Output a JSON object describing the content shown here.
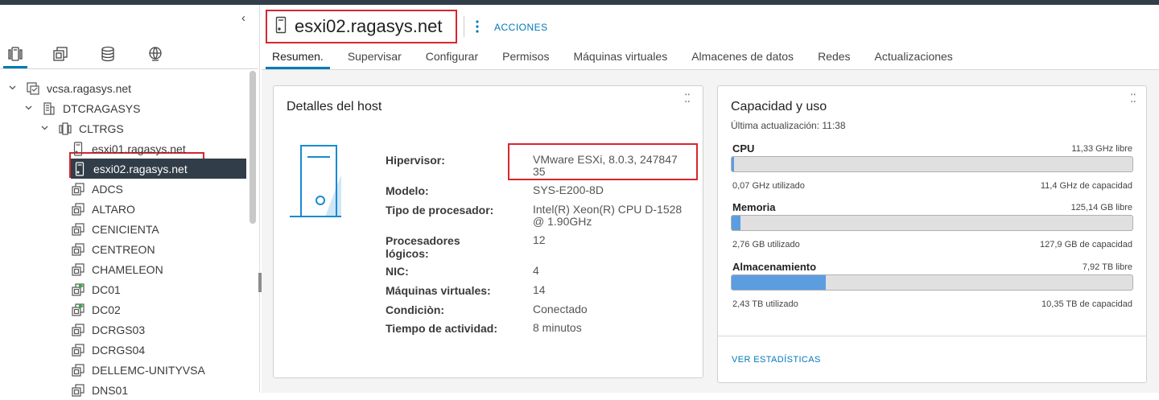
{
  "header": {
    "title": "esxi02.ragasys.net",
    "actions_label": "ACCIONES"
  },
  "tabs": [
    {
      "label": "Resumen."
    },
    {
      "label": "Supervisar"
    },
    {
      "label": "Configurar"
    },
    {
      "label": "Permisos"
    },
    {
      "label": "Máquinas virtuales"
    },
    {
      "label": "Almacenes de datos"
    },
    {
      "label": "Redes"
    },
    {
      "label": "Actualizaciones"
    }
  ],
  "sidebar": {
    "collapse_glyph": "‹",
    "view_icons": [
      "hosts-clusters-icon",
      "vms-templates-icon",
      "storage-icon",
      "networking-icon"
    ],
    "tree": [
      {
        "label": "vcsa.ragasys.net",
        "icon": "vcenter-icon",
        "expanded": true
      },
      {
        "label": "DTCRAGASYS",
        "icon": "datacenter-icon",
        "expanded": true
      },
      {
        "label": "CLTRGS",
        "icon": "cluster-icon",
        "expanded": true
      },
      {
        "label": "esxi01.ragasys.net",
        "icon": "host-icon"
      },
      {
        "label": "esxi02.ragasys.net",
        "icon": "host-icon",
        "selected": true
      },
      {
        "label": "ADCS",
        "icon": "vm-icon"
      },
      {
        "label": "ALTARO",
        "icon": "vm-icon"
      },
      {
        "label": "CENICIENTA",
        "icon": "vm-icon"
      },
      {
        "label": "CENTREON",
        "icon": "vm-icon"
      },
      {
        "label": "CHAMELEON",
        "icon": "vm-icon"
      },
      {
        "label": "DC01",
        "icon": "vm-powered-on-icon"
      },
      {
        "label": "DC02",
        "icon": "vm-powered-on-icon"
      },
      {
        "label": "DCRGS03",
        "icon": "vm-icon"
      },
      {
        "label": "DCRGS04",
        "icon": "vm-icon"
      },
      {
        "label": "DELLEMC-UNITYVSA",
        "icon": "vm-icon"
      },
      {
        "label": "DNS01",
        "icon": "vm-icon"
      }
    ]
  },
  "host_details": {
    "title": "Detalles del host",
    "props": [
      {
        "label": "Hipervisor:",
        "value": "VMware ESXi, 8.0.3, 247847 35"
      },
      {
        "label": "Modelo:",
        "value": "SYS-E200-8D"
      },
      {
        "label": "Tipo de procesador:",
        "value": "Intel(R) Xeon(R) CPU D-1528 @ 1.90GHz"
      },
      {
        "label": "Procesadores lógicos:",
        "value": "12"
      },
      {
        "label": "NIC:",
        "value": "4"
      },
      {
        "label": "Máquinas virtuales:",
        "value": "14"
      },
      {
        "label": "Condiciòn:",
        "value": "Conectado"
      },
      {
        "label": "Tiempo de actividad:",
        "value": "8 minutos"
      }
    ]
  },
  "capacity": {
    "title": "Capacidad y uso",
    "last_update": "Última actualización: 11:38",
    "resources": [
      {
        "name": "CPU",
        "free": "11,33 GHz libre",
        "used": "0,07 GHz utilizado",
        "capacity": "11,4 GHz de capacidad",
        "used_fraction": 0.006
      },
      {
        "name": "Memoria",
        "free": "125,14 GB libre",
        "used": "2,76 GB utilizado",
        "capacity": "127,9 GB de capacidad",
        "used_fraction": 0.022
      },
      {
        "name": "Almacenamiento",
        "free": "7,92 TB libre",
        "used": "2,43 TB utilizado",
        "capacity": "10,35 TB de capacidad",
        "used_fraction": 0.235
      }
    ],
    "stats_link": "VER ESTADÍSTICAS"
  },
  "colors": {
    "accent": "#0079b8",
    "highlight": "#d6262f",
    "selected_bg": "#313d48",
    "bar_fill": "#5c9de0",
    "powered_on": "#3ba549"
  }
}
